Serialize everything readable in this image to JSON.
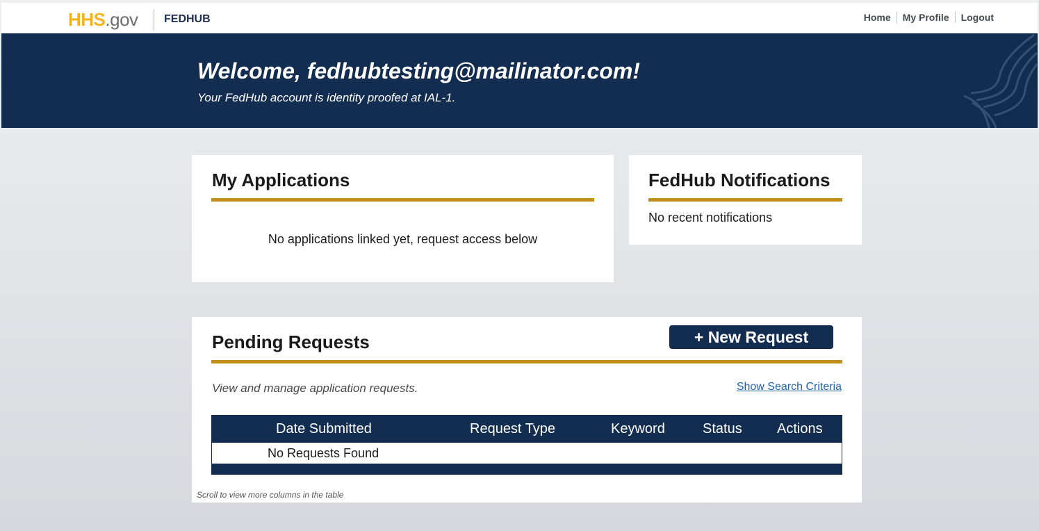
{
  "header": {
    "logo_hhs": "HHS",
    "logo_gov": ".gov",
    "brand": "FEDHUB",
    "nav": [
      "Home",
      "My Profile",
      "Logout"
    ]
  },
  "banner": {
    "welcome": "Welcome, fedhubtesting@mailinator.com!",
    "subtitle": "Your FedHub account is identity proofed at IAL-1."
  },
  "applications": {
    "title": "My Applications",
    "empty_text": "No applications linked yet, request access below"
  },
  "notifications": {
    "title": "FedHub Notifications",
    "empty_text": "No recent notifications"
  },
  "pending": {
    "title": "Pending Requests",
    "new_request_label": "+ New Request",
    "description": "View and manage application requests.",
    "show_search_label": "Show Search Criteria",
    "columns": [
      "Date Submitted",
      "Request Type",
      "Keyword",
      "Status",
      "Actions"
    ],
    "empty_row": "No Requests Found",
    "scroll_hint": "Scroll to view more columns in the table"
  },
  "colors": {
    "navy": "#132d51",
    "gold": "#c28f1a",
    "hhs_yellow": "#f3b51b",
    "link": "#1f61a8"
  }
}
